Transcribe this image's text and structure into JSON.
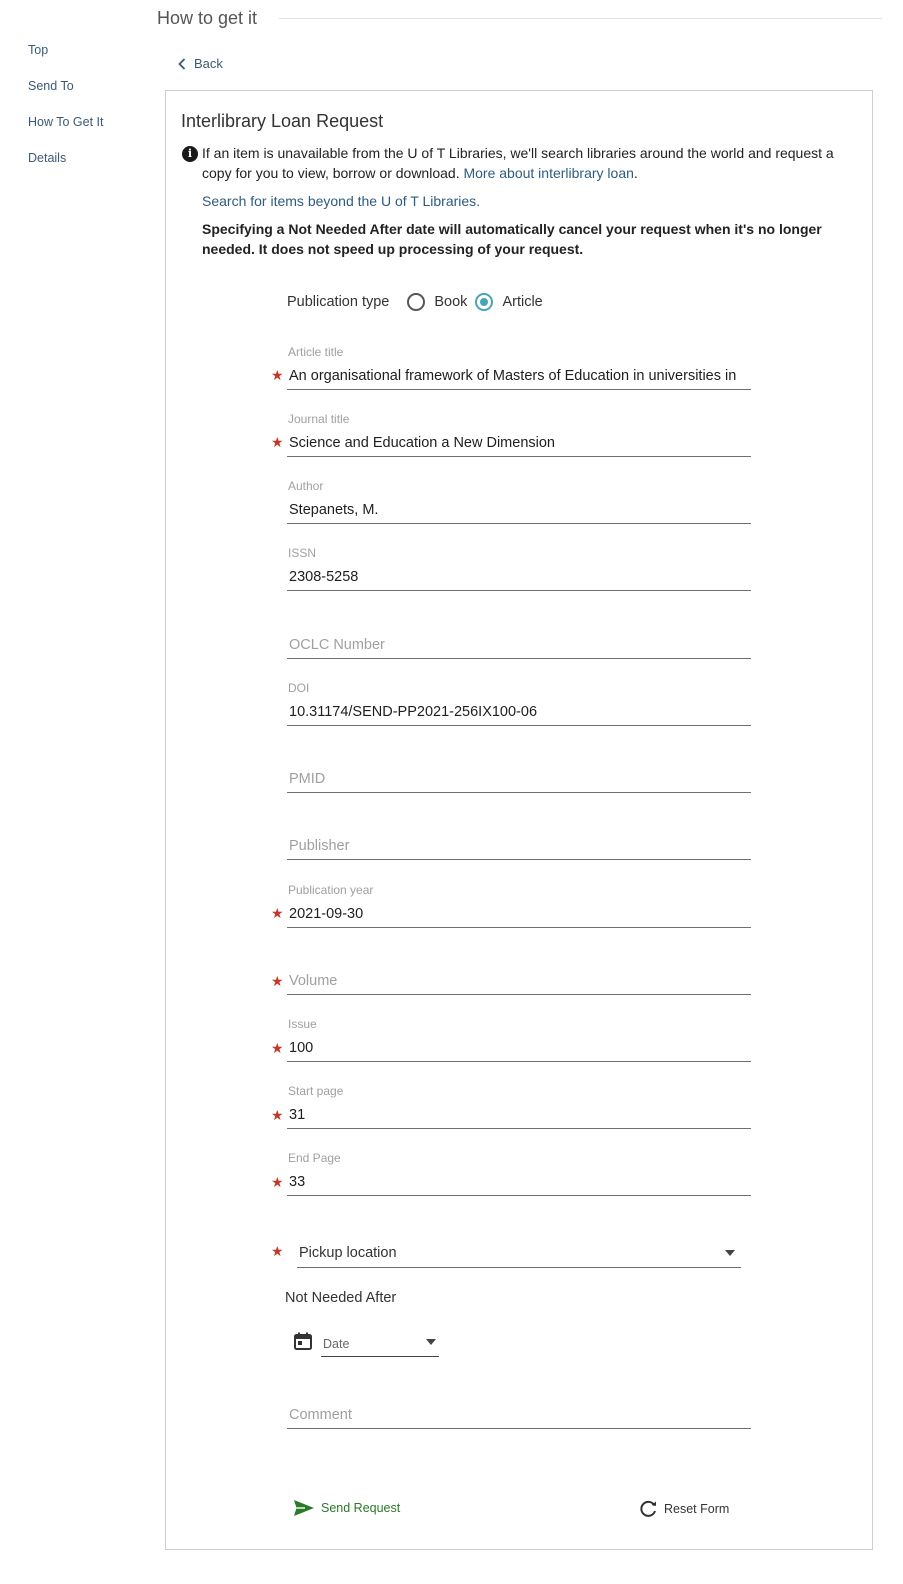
{
  "sidenav": [
    "Top",
    "Send To",
    "How To Get It",
    "Details"
  ],
  "section_title": "How to get it",
  "back_label": "Back",
  "panel": {
    "title": "Interlibrary Loan Request",
    "info_text": "If an item is unavailable from the U of T Libraries, we'll search libraries around the world and request a copy for you to view, borrow or download.",
    "info_link": "More about interlibrary loan",
    "beyond_link": "Search for items beyond the U of T Libraries",
    "warning": "Specifying a Not Needed After date will automatically cancel your request when it's no longer needed. It does not speed up processing of your request."
  },
  "pub_type": {
    "label": "Publication type",
    "options": [
      "Book",
      "Article"
    ],
    "selected": "Article"
  },
  "fields": {
    "article_title": {
      "label": "Article title",
      "value": "An organisational framework of Masters of Education in universities in"
    },
    "journal_title": {
      "label": "Journal title",
      "value": "Science and Education a New Dimension"
    },
    "author": {
      "label": "Author",
      "value": "Stepanets, M."
    },
    "issn": {
      "label": "ISSN",
      "value": "2308-5258"
    },
    "oclc": {
      "placeholder": "OCLC Number"
    },
    "doi": {
      "label": "DOI",
      "value": "10.31174/SEND-PP2021-256IX100-06"
    },
    "pmid": {
      "placeholder": "PMID"
    },
    "publisher": {
      "placeholder": "Publisher"
    },
    "pub_year": {
      "label": "Publication year",
      "value": "2021-09-30"
    },
    "volume": {
      "placeholder": "Volume"
    },
    "issue": {
      "label": "Issue",
      "value": "100"
    },
    "start_page": {
      "label": "Start page",
      "value": "31"
    },
    "end_page": {
      "label": "End Page",
      "value": "33"
    },
    "comment": {
      "placeholder": "Comment"
    }
  },
  "pickup_location": "Pickup location",
  "not_needed_after": "Not Needed After",
  "date_placeholder": "Date",
  "send_label": "Send Request",
  "reset_label": "Reset Form",
  "colors": {
    "accent": "#4aa3b8",
    "link": "#2e5c80",
    "required": "#c0392b",
    "send": "#2a7a2a"
  }
}
